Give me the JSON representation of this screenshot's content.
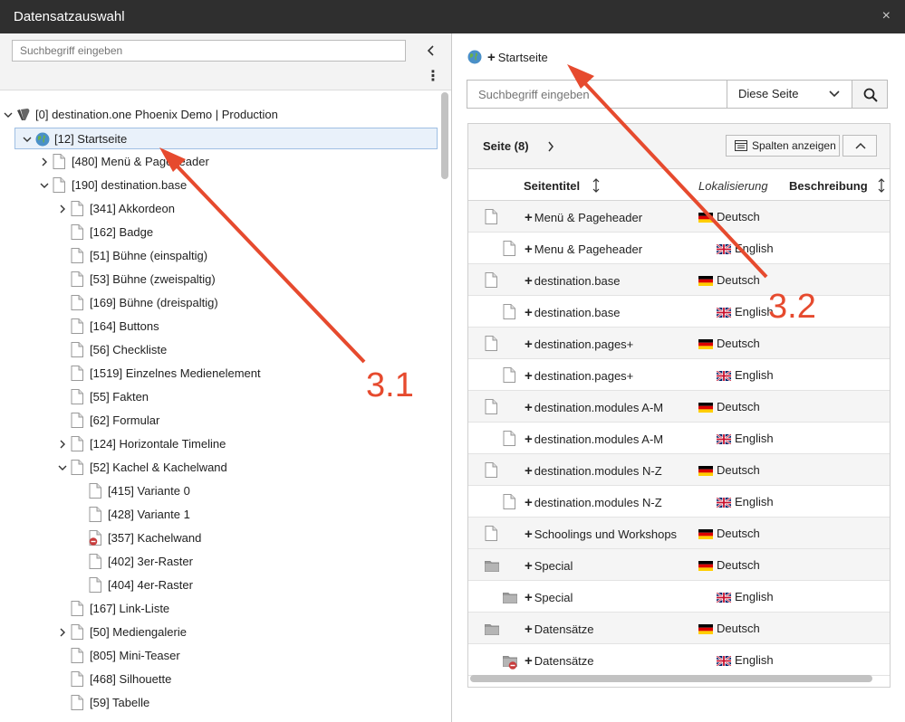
{
  "window": {
    "title": "Datensatzauswahl",
    "close_glyph": "×"
  },
  "left": {
    "search_placeholder": "Suchbegriff eingeben",
    "collapse_glyph": "‹",
    "more_glyph": "⋮",
    "tree": [
      {
        "label": "[0] destination.one Phoenix Demo | Production",
        "level": 0,
        "expander": "open",
        "icon": "typo3-root-icon"
      },
      {
        "label": "[12] Startseite",
        "level": 1,
        "expander": "open",
        "icon": "globe-icon",
        "selected": true
      },
      {
        "label": "[480] Menü & Pageheader",
        "level": 2,
        "expander": "closed",
        "icon": "page-icon"
      },
      {
        "label": "[190] destination.base",
        "level": 2,
        "expander": "open",
        "icon": "page-icon"
      },
      {
        "label": "[341] Akkordeon",
        "level": 3,
        "expander": "closed",
        "icon": "page-icon"
      },
      {
        "label": "[162] Badge",
        "level": 3,
        "expander": "none",
        "icon": "page-icon"
      },
      {
        "label": "[51] Bühne (einspaltig)",
        "level": 3,
        "expander": "none",
        "icon": "page-icon"
      },
      {
        "label": "[53] Bühne (zweispaltig)",
        "level": 3,
        "expander": "none",
        "icon": "page-icon"
      },
      {
        "label": "[169] Bühne (dreispaltig)",
        "level": 3,
        "expander": "none",
        "icon": "page-icon"
      },
      {
        "label": "[164] Buttons",
        "level": 3,
        "expander": "none",
        "icon": "page-icon"
      },
      {
        "label": "[56] Checkliste",
        "level": 3,
        "expander": "none",
        "icon": "page-icon"
      },
      {
        "label": "[1519] Einzelnes Medienelement",
        "level": 3,
        "expander": "none",
        "icon": "page-icon"
      },
      {
        "label": "[55] Fakten",
        "level": 3,
        "expander": "none",
        "icon": "page-icon"
      },
      {
        "label": "[62] Formular",
        "level": 3,
        "expander": "none",
        "icon": "page-icon"
      },
      {
        "label": "[124] Horizontale Timeline",
        "level": 3,
        "expander": "closed",
        "icon": "page-icon"
      },
      {
        "label": "[52] Kachel & Kachelwand",
        "level": 3,
        "expander": "open",
        "icon": "page-icon"
      },
      {
        "label": "[415] Variante 0",
        "level": 4,
        "expander": "none",
        "icon": "page-icon"
      },
      {
        "label": "[428] Variante 1",
        "level": 4,
        "expander": "none",
        "icon": "page-icon"
      },
      {
        "label": "[357] Kachelwand",
        "level": 4,
        "expander": "none",
        "icon": "page-hidden-icon"
      },
      {
        "label": "[402] 3er-Raster",
        "level": 4,
        "expander": "none",
        "icon": "page-icon"
      },
      {
        "label": "[404] 4er-Raster",
        "level": 4,
        "expander": "none",
        "icon": "page-icon"
      },
      {
        "label": "[167] Link-Liste",
        "level": 3,
        "expander": "none",
        "icon": "page-icon"
      },
      {
        "label": "[50] Mediengalerie",
        "level": 3,
        "expander": "closed",
        "icon": "page-icon"
      },
      {
        "label": "[805] Mini-Teaser",
        "level": 3,
        "expander": "none",
        "icon": "page-icon"
      },
      {
        "label": "[468] Silhouette",
        "level": 3,
        "expander": "none",
        "icon": "page-icon"
      },
      {
        "label": "[59] Tabelle",
        "level": 3,
        "expander": "none",
        "icon": "page-icon"
      }
    ]
  },
  "right": {
    "breadcrumb": {
      "plus": "+",
      "label": "Startseite"
    },
    "search_placeholder": "Suchbegriff eingeben",
    "select_value": "Diese Seite",
    "panel": {
      "title": "Seite (8)",
      "columns_button": "Spalten anzeigen",
      "headers": {
        "title": "Seitentitel",
        "localization": "Lokalisierung",
        "description": "Beschreibung"
      },
      "rows": [
        {
          "title": "Menü & Pageheader",
          "lang": "Deutsch",
          "flag": "de",
          "icon": "page-icon",
          "translation": false
        },
        {
          "title": "Menu & Pageheader",
          "lang": "English",
          "flag": "gb",
          "icon": "page-icon",
          "translation": true
        },
        {
          "title": "destination.base",
          "lang": "Deutsch",
          "flag": "de",
          "icon": "page-icon",
          "translation": false
        },
        {
          "title": "destination.base",
          "lang": "English",
          "flag": "gb",
          "icon": "page-icon",
          "translation": true
        },
        {
          "title": "destination.pages+",
          "lang": "Deutsch",
          "flag": "de",
          "icon": "page-icon",
          "translation": false
        },
        {
          "title": "destination.pages+",
          "lang": "English",
          "flag": "gb",
          "icon": "page-icon",
          "translation": true
        },
        {
          "title": "destination.modules A-M",
          "lang": "Deutsch",
          "flag": "de",
          "icon": "page-icon",
          "translation": false
        },
        {
          "title": "destination.modules A-M",
          "lang": "English",
          "flag": "gb",
          "icon": "page-icon",
          "translation": true
        },
        {
          "title": "destination.modules N-Z",
          "lang": "Deutsch",
          "flag": "de",
          "icon": "page-icon",
          "translation": false
        },
        {
          "title": "destination.modules N-Z",
          "lang": "English",
          "flag": "gb",
          "icon": "page-icon",
          "translation": true
        },
        {
          "title": "Schoolings und Workshops",
          "lang": "Deutsch",
          "flag": "de",
          "icon": "page-icon",
          "translation": false
        },
        {
          "title": "Special",
          "lang": "Deutsch",
          "flag": "de",
          "icon": "folder-icon",
          "translation": false
        },
        {
          "title": "Special",
          "lang": "English",
          "flag": "gb",
          "icon": "folder-icon",
          "translation": true
        },
        {
          "title": "Datensätze",
          "lang": "Deutsch",
          "flag": "de",
          "icon": "folder-icon",
          "translation": false
        },
        {
          "title": "Datensätze",
          "lang": "English",
          "flag": "gb",
          "icon": "folder-hidden-icon",
          "translation": true
        }
      ]
    }
  },
  "annotations": {
    "left": "3.1",
    "right": "3.2",
    "color": "#e64a2e"
  }
}
